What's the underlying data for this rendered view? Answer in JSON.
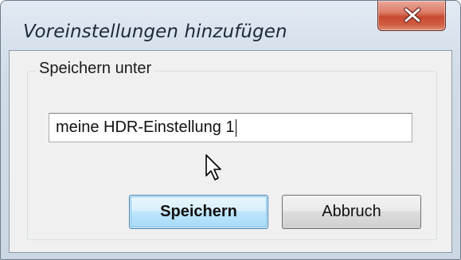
{
  "window": {
    "title": "Voreinstellungen hinzufügen"
  },
  "group": {
    "legend": "Speichern unter"
  },
  "name_field": {
    "value": "meine HDR-Einstellung 1"
  },
  "buttons": {
    "save_label": "Speichern",
    "cancel_label": "Abbruch"
  },
  "icons": {
    "close": "close-icon",
    "cursor": "mouse-pointer-icon"
  },
  "colors": {
    "close_button": "#c84a30",
    "default_button": "#bee6fd",
    "title_text": "#1e2a3a"
  }
}
